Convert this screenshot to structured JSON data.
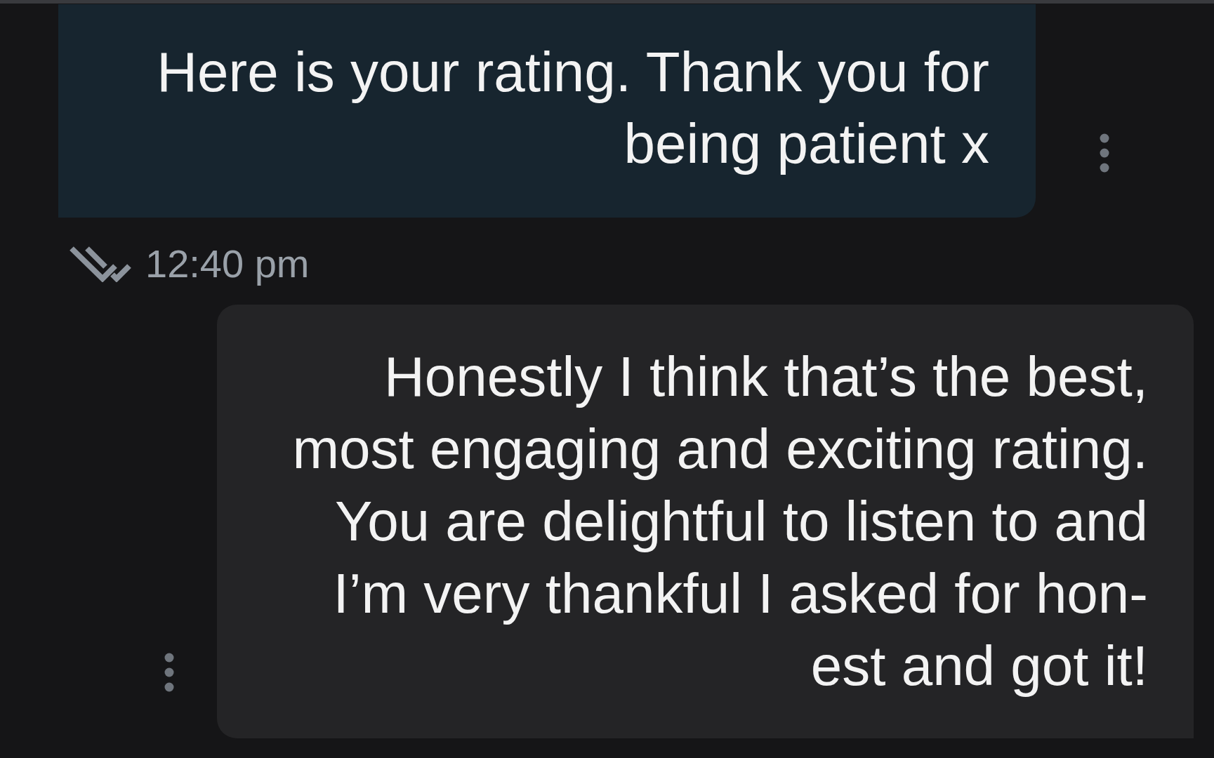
{
  "messages": [
    {
      "kind": "sent",
      "lines": [
        "Here is your rating. Thank you for",
        "being patient x"
      ],
      "time": "12:40 pm",
      "read": true
    },
    {
      "kind": "received",
      "lines": [
        "Honestly I think that’s the best,",
        "most engaging and exciting rating.",
        "You are delightful to listen to and",
        "I’m very thankful I asked for hon-",
        "est and got it!"
      ]
    }
  ]
}
